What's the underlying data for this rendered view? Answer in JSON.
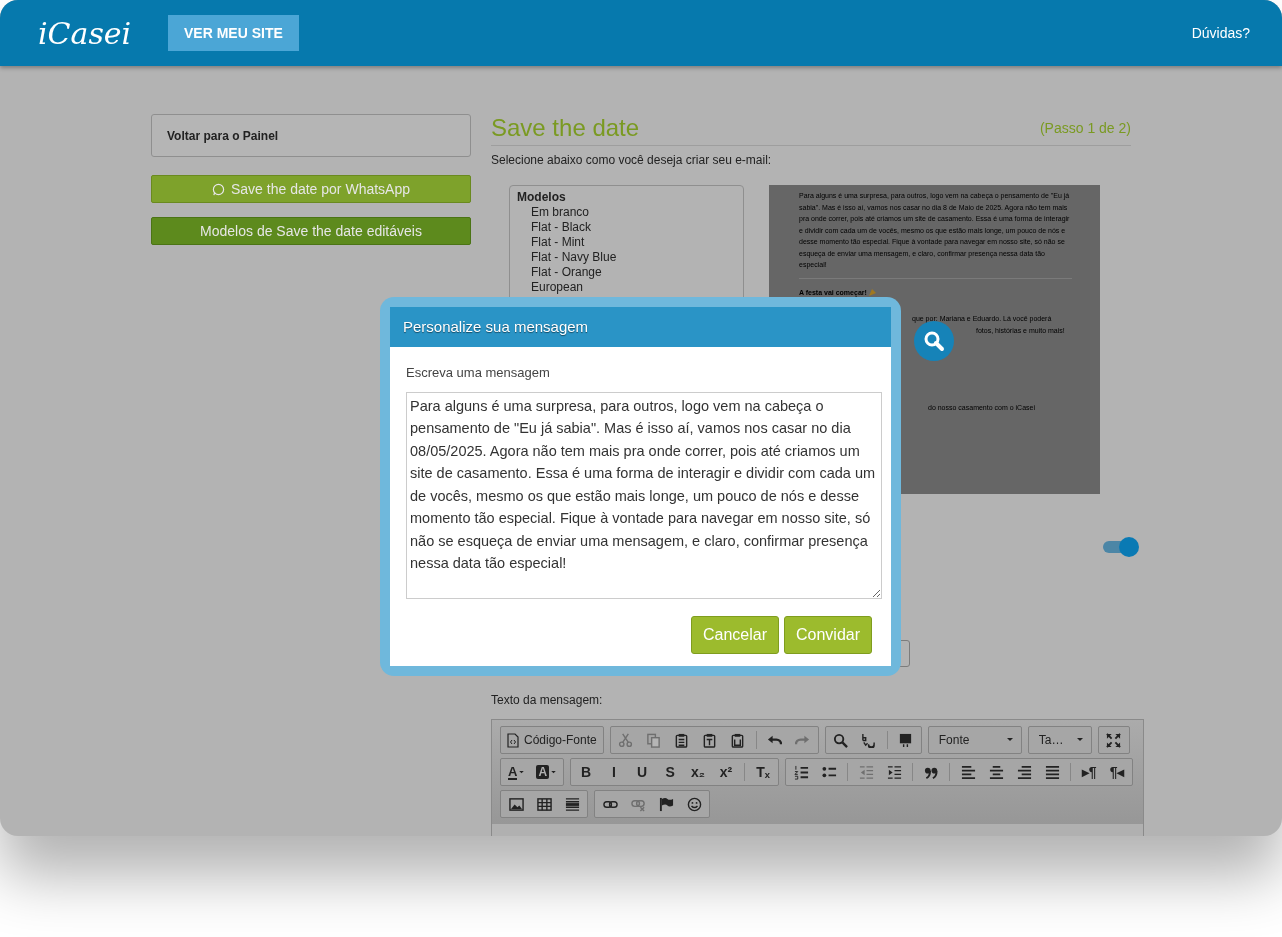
{
  "header": {
    "logo": "iCasei",
    "site_button": "VER MEU SITE",
    "help_link": "Dúvidas?"
  },
  "sidebar": {
    "back_link": "Voltar para o Painel",
    "buttons": [
      {
        "label": "Save the date por WhatsApp",
        "kind": "whatsapp"
      },
      {
        "label": "Modelos de Save the date editáveis",
        "kind": "plain"
      }
    ]
  },
  "page": {
    "title": "Save the date",
    "step": "(Passo 1 de 2)",
    "subtitle": "Selecione abaixo como você deseja criar seu e-mail:"
  },
  "models": {
    "heading": "Modelos",
    "items": [
      "Em branco",
      "Flat - Black",
      "Flat - Mint",
      "Flat - Navy Blue",
      "Flat - Orange",
      "European"
    ]
  },
  "preview": {
    "paragraph": "Para alguns é uma surpresa, para outros, logo vem na cabeça o pensamento de \"Eu já sabia\". Mas é isso aí, vamos nos casar no dia 8 de Maio de 2025. Agora não tem mais pra onde correr, pois até criamos um site de casamento. Essa é uma forma de interagir e dividir com cada um de vocês, mesmo os que estão mais longe, um pouco de nós e desse momento tão especial. Fique à vontade para navegar em nosso site, só não se esqueça de enviar uma mensagem, e claro, confirmar presença nessa data tão especial!",
    "heading": "A festa vai começar!",
    "partial_lines": [
      "que por: Mariana e Eduardo. Lá você poderá",
      "fotos, histórias e muito mais!",
      "do nosso casamento com o iCasei"
    ]
  },
  "toggle": {
    "on": true
  },
  "editor": {
    "label": "Texto da mensagem:",
    "toolbar": [
      [
        [
          {
            "kind": "source",
            "label": "Código-Fonte",
            "disabled": false
          }
        ],
        [
          {
            "kind": "icon",
            "disabled": true
          },
          {
            "kind": "icon",
            "disabled": true
          },
          {
            "kind": "icon",
            "disabled": false
          },
          {
            "kind": "icon",
            "disabled": false
          },
          {
            "kind": "icon",
            "disabled": false
          },
          {
            "kind": "separator"
          },
          {
            "kind": "icon",
            "disabled": false
          },
          {
            "kind": "icon",
            "disabled": true
          }
        ],
        [
          {
            "kind": "icon",
            "disabled": false
          },
          {
            "kind": "icon",
            "disabled": false
          },
          {
            "kind": "separator"
          },
          {
            "kind": "icon",
            "disabled": false
          }
        ],
        [
          {
            "kind": "dropdown",
            "label": "Fonte",
            "disabled": false
          }
        ],
        [
          {
            "kind": "dropdown",
            "label": "Ta…",
            "disabled": false
          }
        ],
        [
          {
            "kind": "icon",
            "disabled": false
          }
        ]
      ],
      [
        [
          {
            "kind": "text-color",
            "label": "A",
            "disabled": false
          },
          {
            "kind": "bg-color",
            "label": "A",
            "disabled": false
          }
        ],
        [
          {
            "kind": "glyph",
            "label": "B",
            "disabled": false
          },
          {
            "kind": "glyph",
            "label": "I",
            "disabled": false
          },
          {
            "kind": "glyph",
            "label": "U",
            "disabled": false
          },
          {
            "kind": "glyph",
            "label": "S",
            "disabled": false
          },
          {
            "kind": "glyph",
            "label": "x₂",
            "disabled": false
          },
          {
            "kind": "glyph",
            "label": "x²",
            "disabled": false
          },
          {
            "kind": "separator"
          },
          {
            "kind": "glyph",
            "label": "Tₓ",
            "disabled": false
          }
        ],
        [
          {
            "kind": "icon",
            "disabled": false
          },
          {
            "kind": "icon",
            "disabled": false
          },
          {
            "kind": "separator"
          },
          {
            "kind": "icon",
            "disabled": true
          },
          {
            "kind": "icon",
            "disabled": false
          },
          {
            "kind": "separator"
          },
          {
            "kind": "icon",
            "disabled": false
          },
          {
            "kind": "separator"
          },
          {
            "kind": "icon",
            "disabled": false
          },
          {
            "kind": "icon",
            "disabled": false
          },
          {
            "kind": "icon",
            "disabled": false
          },
          {
            "kind": "icon",
            "disabled": false
          },
          {
            "kind": "separator"
          },
          {
            "kind": "glyph",
            "label": "▸¶",
            "disabled": false
          },
          {
            "kind": "glyph",
            "label": "¶◂",
            "disabled": false
          }
        ]
      ],
      [
        [
          {
            "kind": "icon",
            "disabled": false
          },
          {
            "kind": "icon",
            "disabled": false
          },
          {
            "kind": "icon",
            "disabled": false
          }
        ],
        [
          {
            "kind": "icon",
            "disabled": false
          },
          {
            "kind": "icon",
            "disabled": true
          },
          {
            "kind": "icon",
            "disabled": false
          },
          {
            "kind": "icon",
            "disabled": false
          }
        ]
      ]
    ]
  },
  "modal": {
    "title": "Personalize sua mensagem",
    "field_label": "Escreva uma mensagem",
    "message": "Para alguns é uma surpresa, para outros, logo vem na cabeça o pensamento de \"Eu já sabia\". Mas é isso aí, vamos nos casar no dia 08/05/2025. Agora não tem mais pra onde correr, pois até criamos um site de casamento. Essa é uma forma de interagir e dividir com cada um de vocês, mesmo os que estão mais longe, um pouco de nós e desse momento tão especial. Fique à vontade para navegar em nosso site, só não se esqueça de enviar uma mensagem, e claro, confirmar presença nessa data tão especial!",
    "buttons": [
      "Cancelar",
      "Convidar"
    ]
  }
}
